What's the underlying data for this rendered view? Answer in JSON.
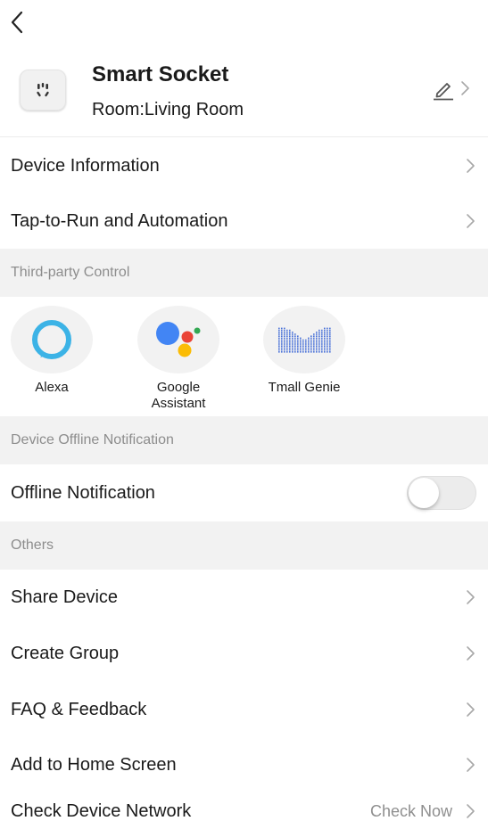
{
  "header": {
    "device_name": "Smart Socket",
    "room_label": "Room:Living Room"
  },
  "menu": {
    "device_information": "Device Information",
    "tap_to_run": "Tap-to-Run and Automation"
  },
  "third_party": {
    "section_title": "Third-party Control",
    "items": [
      {
        "label": "Alexa",
        "icon": "alexa-icon"
      },
      {
        "label": "Google\nAssistant",
        "icon": "google-assistant-icon"
      },
      {
        "label": "Tmall Genie",
        "icon": "tmall-genie-icon"
      }
    ]
  },
  "offline": {
    "section_title": "Device Offline Notification",
    "label": "Offline Notification",
    "enabled": false
  },
  "others": {
    "section_title": "Others",
    "share_device": "Share Device",
    "create_group": "Create Group",
    "faq_feedback": "FAQ & Feedback",
    "add_home_screen": "Add to Home Screen",
    "check_network": "Check Device Network",
    "check_now": "Check Now"
  },
  "colors": {
    "alexa_ring": "#3cb3e6",
    "google_blue": "#4285f4",
    "google_red": "#ea4335",
    "google_yellow": "#fbbc05",
    "google_green": "#34a853",
    "tmall_blue": "#4a72d8"
  }
}
